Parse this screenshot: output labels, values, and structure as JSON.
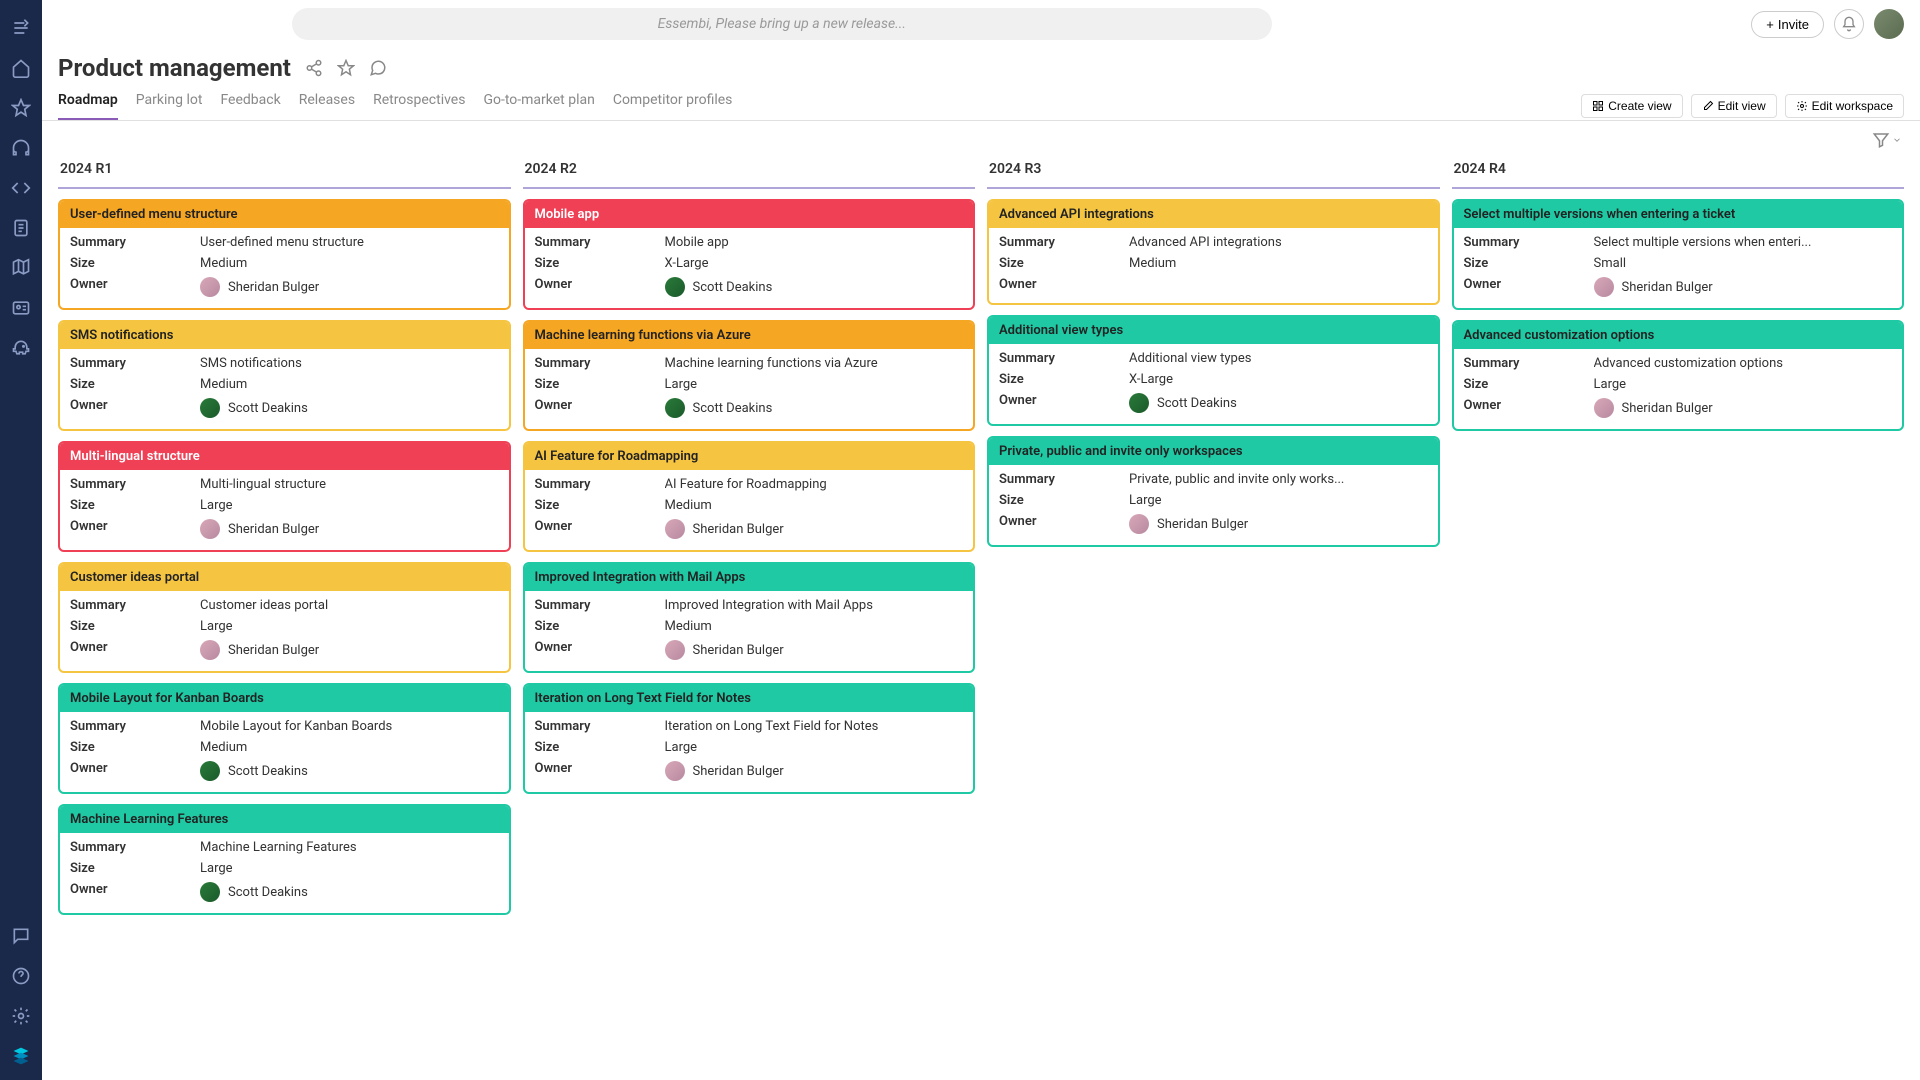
{
  "search": {
    "placeholder": "Essembi, Please bring up a new release..."
  },
  "topbar": {
    "invite": "Invite"
  },
  "page": {
    "title": "Product management"
  },
  "tabs": {
    "items": [
      "Roadmap",
      "Parking lot",
      "Feedback",
      "Releases",
      "Retrospectives",
      "Go-to-market plan",
      "Competitor profiles"
    ],
    "active": 0,
    "actions": {
      "create": "Create view",
      "edit": "Edit view",
      "editws": "Edit workspace"
    }
  },
  "labels": {
    "summary": "Summary",
    "size": "Size",
    "owner": "Owner"
  },
  "owners": {
    "scott": "Scott Deakins",
    "sheridan": "Sheridan Bulger"
  },
  "columns": [
    {
      "title": "2024 R1",
      "cards": [
        {
          "color": "orange",
          "title": "User-defined menu structure",
          "summary": "User-defined menu structure",
          "size": "Medium",
          "owner": "sheridan"
        },
        {
          "color": "yellow",
          "title": "SMS notifications",
          "summary": "SMS notifications",
          "size": "Medium",
          "owner": "scott"
        },
        {
          "color": "red",
          "title": "Multi-lingual structure",
          "summary": "Multi-lingual structure",
          "size": "Large",
          "owner": "sheridan"
        },
        {
          "color": "yellow",
          "title": "Customer ideas portal",
          "summary": "Customer ideas portal",
          "size": "Large",
          "owner": "sheridan"
        },
        {
          "color": "teal",
          "title": "Mobile Layout for Kanban Boards",
          "summary": "Mobile Layout for Kanban Boards",
          "size": "Medium",
          "owner": "scott"
        },
        {
          "color": "teal",
          "title": "Machine Learning Features",
          "summary": "Machine Learning Features",
          "size": "Large",
          "owner": "scott"
        }
      ]
    },
    {
      "title": "2024 R2",
      "cards": [
        {
          "color": "red",
          "title": "Mobile app",
          "summary": "Mobile app",
          "size": "X-Large",
          "owner": "scott"
        },
        {
          "color": "orange",
          "title": "Machine learning functions via Azure",
          "summary": "Machine learning functions via Azure",
          "size": "Large",
          "owner": "scott"
        },
        {
          "color": "yellow",
          "title": "AI Feature for Roadmapping",
          "summary": "AI Feature for Roadmapping",
          "size": "Medium",
          "owner": "sheridan"
        },
        {
          "color": "teal",
          "title": "Improved Integration with Mail Apps",
          "summary": "Improved Integration with Mail Apps",
          "size": "Medium",
          "owner": "sheridan"
        },
        {
          "color": "teal",
          "title": "Iteration on Long Text Field for Notes",
          "summary": "Iteration on Long Text Field for Notes",
          "size": "Large",
          "owner": "sheridan"
        }
      ]
    },
    {
      "title": "2024 R3",
      "cards": [
        {
          "color": "yellow",
          "title": "Advanced API integrations",
          "summary": "Advanced API integrations",
          "size": "Medium",
          "owner": ""
        },
        {
          "color": "teal",
          "title": "Additional view types",
          "summary": "Additional view types",
          "size": "X-Large",
          "owner": "scott"
        },
        {
          "color": "teal",
          "title": "Private, public and invite only workspaces",
          "summary": "Private, public and invite only works...",
          "size": "Large",
          "owner": "sheridan"
        }
      ]
    },
    {
      "title": "2024 R4",
      "cards": [
        {
          "color": "teal",
          "title": "Select multiple versions when entering a ticket",
          "summary": "Select multiple versions when enteri...",
          "size": "Small",
          "owner": "sheridan"
        },
        {
          "color": "teal",
          "title": "Advanced customization options",
          "summary": "Advanced customization options",
          "size": "Large",
          "owner": "sheridan"
        }
      ]
    }
  ]
}
